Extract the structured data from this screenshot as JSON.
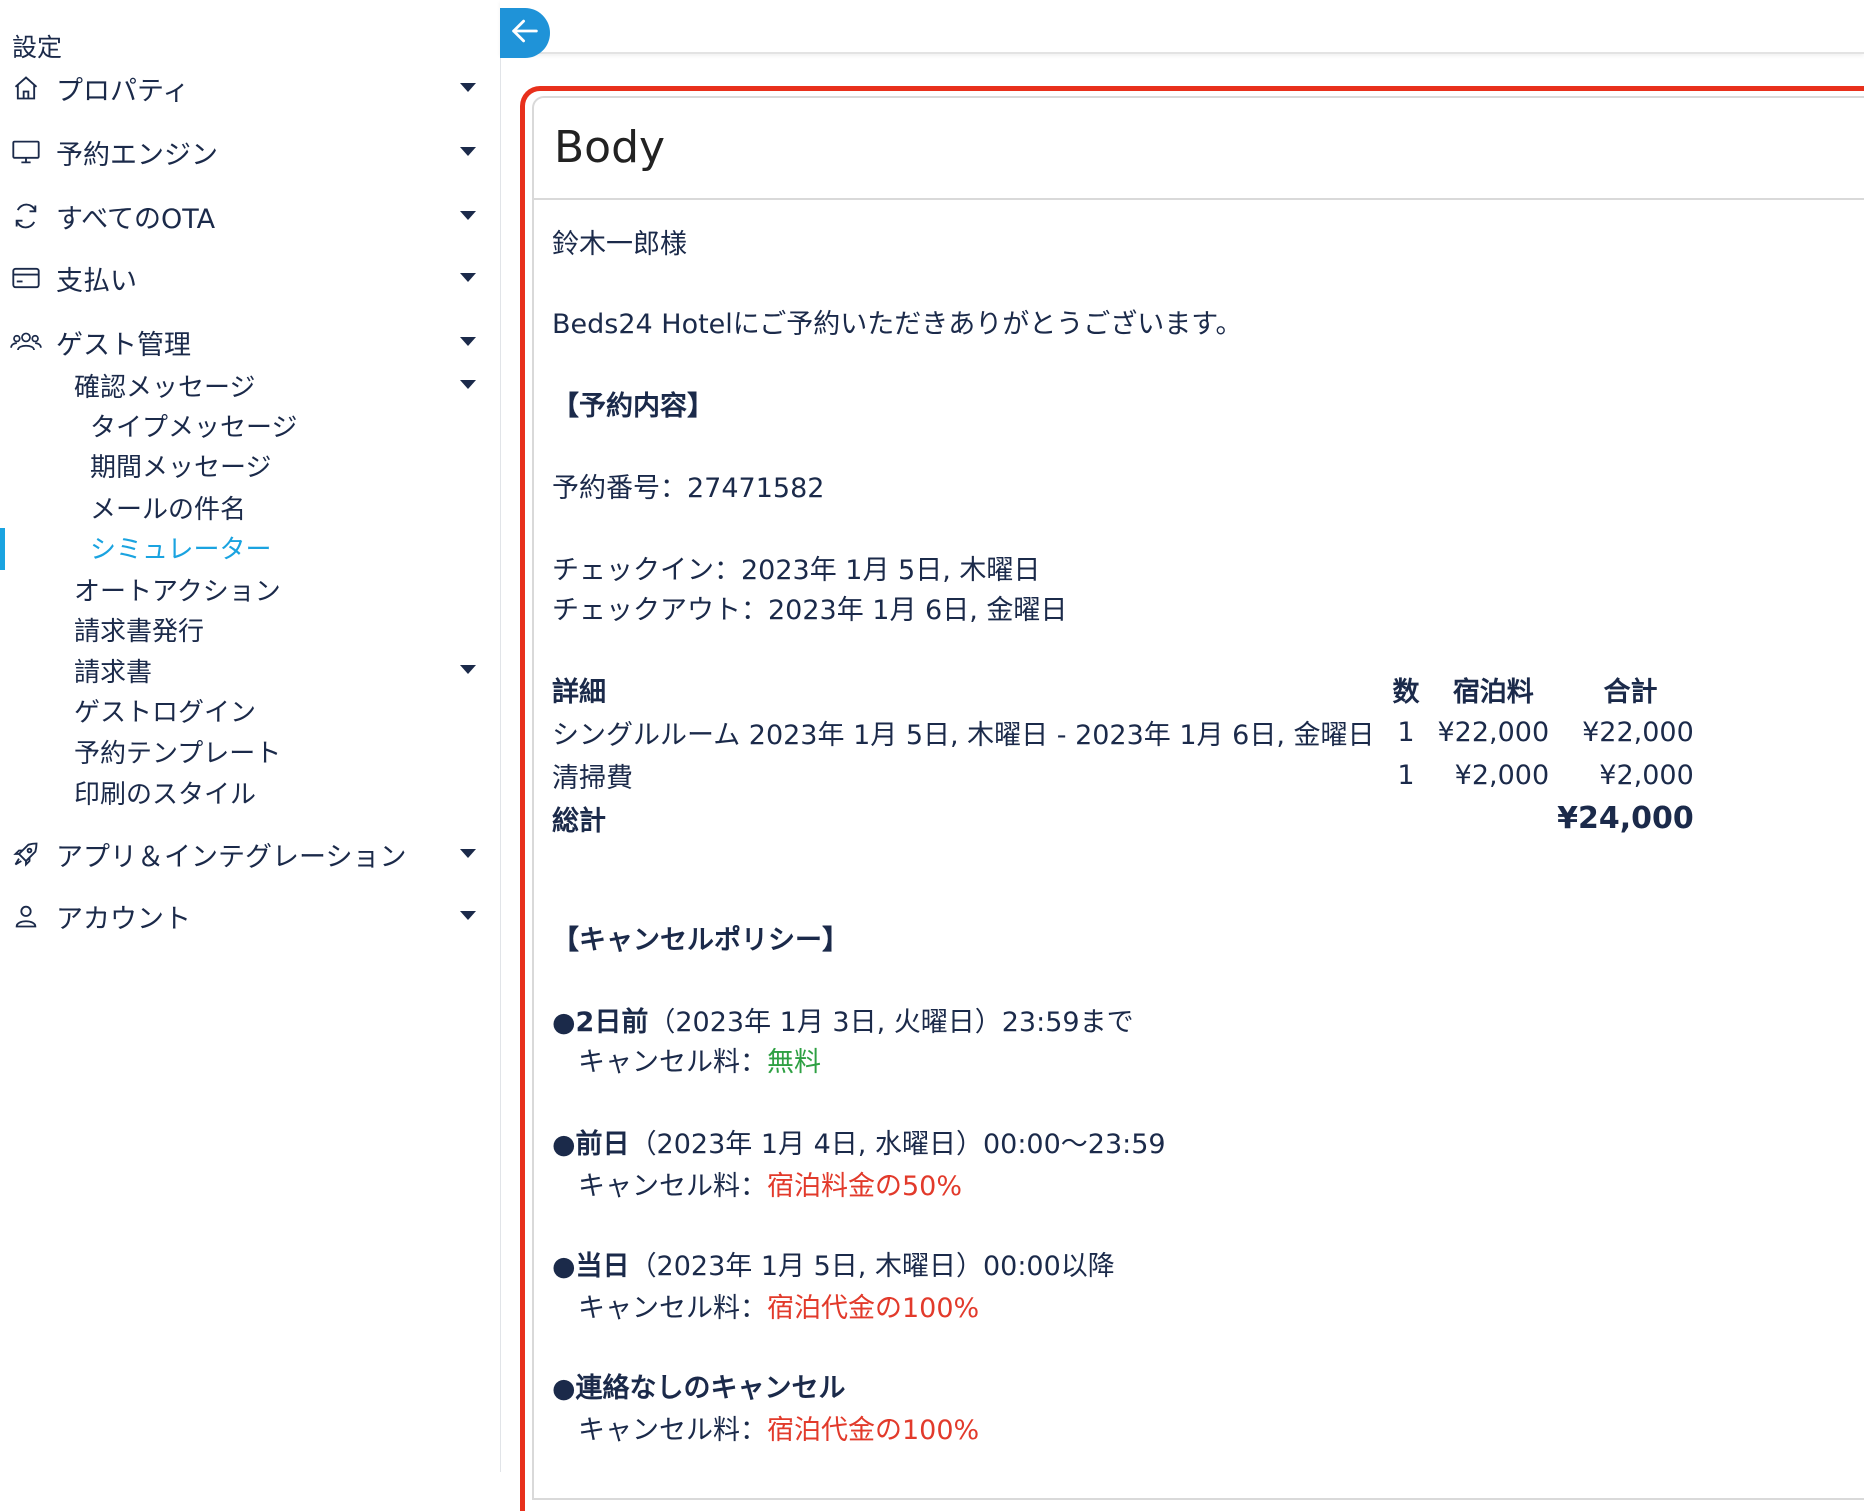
{
  "sidebar": {
    "title": "設定",
    "items": [
      {
        "label": "プロパティ",
        "icon": "home-icon"
      },
      {
        "label": "予約エンジン",
        "icon": "monitor-icon"
      },
      {
        "label": "すべてのOTA",
        "icon": "sync-icon"
      },
      {
        "label": "支払い",
        "icon": "credit-card-icon"
      },
      {
        "label": "ゲスト管理",
        "icon": "users-icon"
      },
      {
        "label": "アプリ＆インテグレーション",
        "icon": "rocket-icon"
      },
      {
        "label": "アカウント",
        "icon": "user-icon"
      }
    ],
    "guest_sub": {
      "confirm_messages": "確認メッセージ",
      "confirm_children": [
        "タイプメッセージ",
        "期間メッセージ",
        "メールの件名",
        "シミュレーター"
      ],
      "others": [
        "オートアクション",
        "請求書発行",
        "請求書",
        "ゲストログイン",
        "予約テンプレート",
        "印刷のスタイル"
      ]
    },
    "active_item": "シミュレーター",
    "accent_color": "#1aa3e0"
  },
  "card": {
    "header": "Body"
  },
  "email": {
    "greeting": "鈴木一郎様",
    "thanks": "Beds24 Hotelにご予約いただきありがとうございます。",
    "section_reservation": "【予約内容】",
    "booking_number": "予約番号：27471582",
    "checkin": "チェックイン：2023年 1月 5日, 木曜日",
    "checkout": "チェックアウト：2023年 1月 6日, 金曜日",
    "table": {
      "headers": [
        "詳細",
        "数",
        "宿泊料",
        "合計"
      ],
      "rows": [
        [
          "シングルルーム 2023年 1月 5日, 木曜日 - 2023年 1月 6日, 金曜日",
          "1",
          "¥22,000",
          "¥22,000"
        ],
        [
          "清掃費",
          "1",
          "¥2,000",
          "¥2,000"
        ]
      ],
      "total_label": "総計",
      "total_value": "¥24,000"
    },
    "section_cancel": "【キャンセルポリシー】",
    "fee_label": "キャンセル料：",
    "policies": [
      {
        "title": "●2日前",
        "detail": "（2023年 1月 3日, 火曜日）23:59まで",
        "fee": "無料",
        "fee_color": "#2ea043"
      },
      {
        "title": "●前日",
        "detail": "（2023年 1月 4日, 水曜日）00:00〜23:59",
        "fee": "宿泊料金の50%",
        "fee_color": "#e23a2b"
      },
      {
        "title": "●当日",
        "detail": "（2023年 1月 5日, 木曜日）00:00以降",
        "fee": "宿泊代金の100%",
        "fee_color": "#e23a2b"
      },
      {
        "title": "●連絡なしのキャンセル",
        "detail": "",
        "fee": "宿泊代金の100%",
        "fee_color": "#e23a2b"
      }
    ]
  }
}
